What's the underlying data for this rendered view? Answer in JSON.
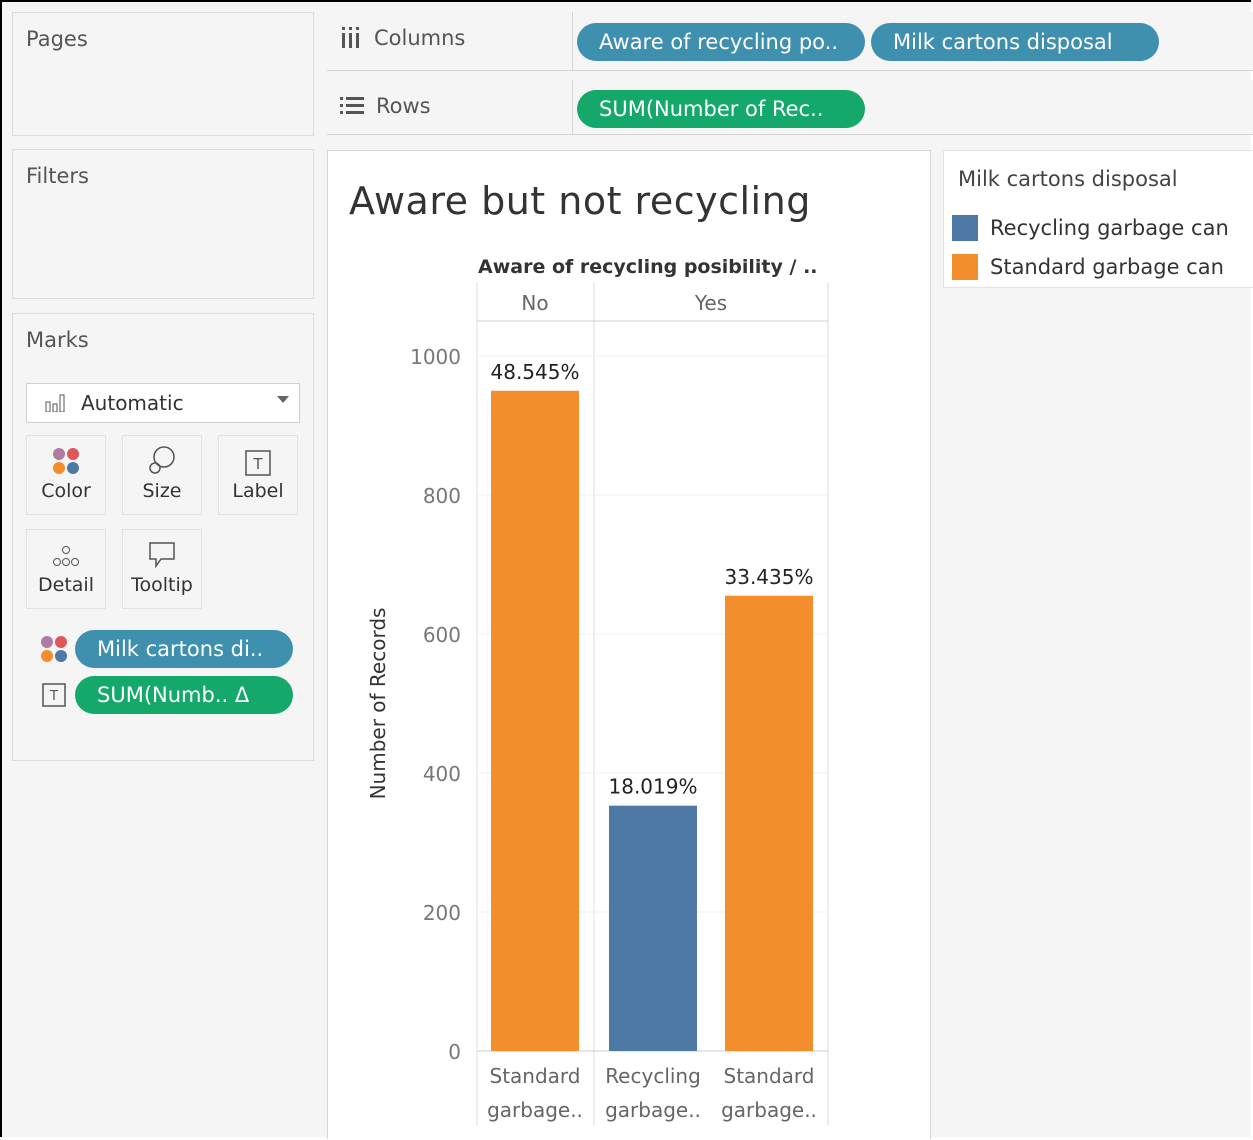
{
  "colors": {
    "recycling": "#4e79a7",
    "standard": "#f28e2b",
    "pill_blue": "#3f8fae",
    "pill_green": "#14a86b"
  },
  "pages_panel": {
    "title": "Pages"
  },
  "filters_panel": {
    "title": "Filters"
  },
  "marks_panel": {
    "title": "Marks",
    "mark_type": "Automatic",
    "buttons": {
      "color": "Color",
      "size": "Size",
      "label": "Label",
      "detail": "Detail",
      "tooltip": "Tooltip"
    },
    "pills": {
      "color_pill": "Milk cartons di..",
      "label_pill": "SUM(Numb..  Δ"
    }
  },
  "columns_shelf": {
    "label": "Columns",
    "pills": [
      "Aware of recycling po..",
      "Milk cartons disposal"
    ]
  },
  "rows_shelf": {
    "label": "Rows",
    "pills": [
      "SUM(Number of Rec.."
    ]
  },
  "sheet": {
    "title": "Aware but not recycling"
  },
  "legend": {
    "title": "Milk cartons disposal",
    "items": [
      {
        "label": "Recycling garbage can",
        "color": "#4e79a7"
      },
      {
        "label": "Standard garbage can",
        "color": "#f28e2b"
      }
    ]
  },
  "chart_data": {
    "type": "bar",
    "title": "Aware but not recycling",
    "header": "Aware of recycling posibility / ..",
    "panes": [
      "No",
      "Yes"
    ],
    "ylabel": "Number of Records",
    "ylim": [
      0,
      1000
    ],
    "yticks": [
      0,
      200,
      400,
      600,
      800,
      1000
    ],
    "grid": true,
    "bars": [
      {
        "pane": "No",
        "category": [
          "Standard",
          "garbage.."
        ],
        "series": "Standard garbage can",
        "value": 950,
        "label": "48.545%",
        "color": "#f28e2b"
      },
      {
        "pane": "Yes",
        "category": [
          "Recycling",
          "garbage.."
        ],
        "series": "Recycling garbage can",
        "value": 353,
        "label": "18.019%",
        "color": "#4e79a7"
      },
      {
        "pane": "Yes",
        "category": [
          "Standard",
          "garbage.."
        ],
        "series": "Standard garbage can",
        "value": 655,
        "label": "33.435%",
        "color": "#f28e2b"
      }
    ]
  }
}
